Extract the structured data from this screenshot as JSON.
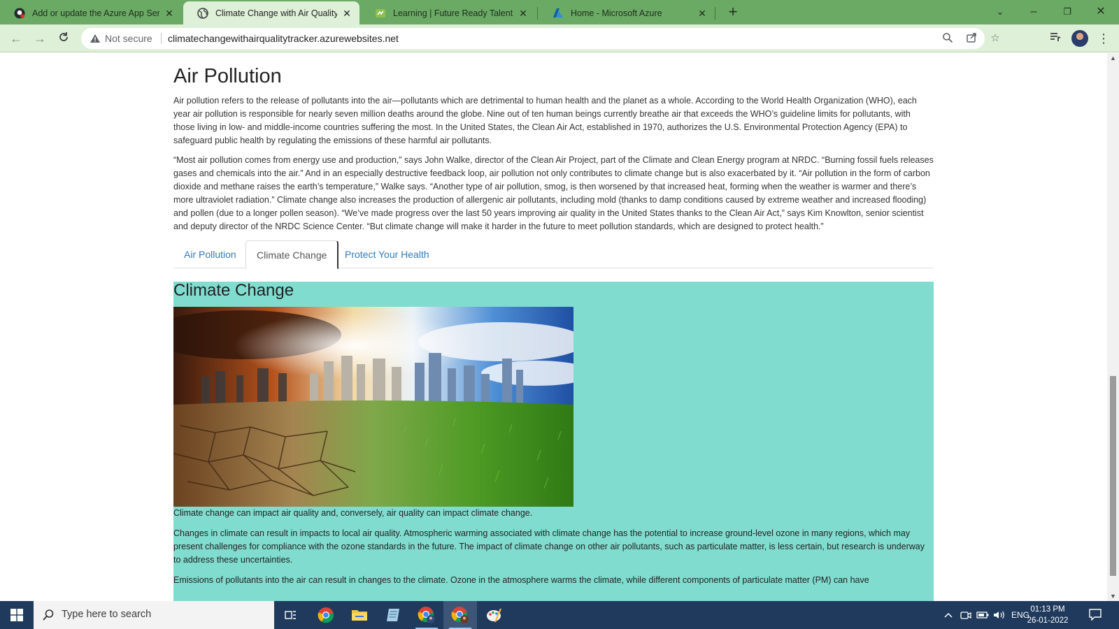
{
  "browser": {
    "tabs": [
      {
        "title": "Add or update the Azure App Servic",
        "icon": "github-icon",
        "active": false
      },
      {
        "title": "Climate Change with Air Quality Tra",
        "icon": "globe-icon",
        "active": true
      },
      {
        "title": "Learning | Future Ready Talent",
        "icon": "future-ready-icon",
        "active": false
      },
      {
        "title": "Home - Microsoft Azure",
        "icon": "azure-icon",
        "active": false
      }
    ],
    "security_label": "Not secure",
    "url": "climatechangewithairqualitytracker.azurewebsites.net"
  },
  "page": {
    "heading": "Air Pollution",
    "paragraphs": [
      "Air pollution refers to the release of pollutants into the air—pollutants which are detrimental to human health and the planet as a whole. According to the World Health Organization (WHO), each year air pollution is responsible for nearly seven million deaths around the globe. Nine out of ten human beings currently breathe air that exceeds the WHO’s guideline limits for pollutants, with those living in low- and middle-income countries suffering the most. In the United States, the Clean Air Act, established in 1970, authorizes the U.S. Environmental Protection Agency (EPA) to safeguard public health by regulating the emissions of these harmful air pollutants.",
      "“Most air pollution comes from energy use and production,” says John Walke, director of the Clean Air Project, part of the Climate and Clean Energy program at NRDC. “Burning fossil fuels releases gases and chemicals into the air.” And in an especially destructive feedback loop, air pollution not only contributes to climate change but is also exacerbated by it. “Air pollution in the form of carbon dioxide and methane raises the earth’s temperature,” Walke says. “Another type of air pollution, smog, is then worsened by that increased heat, forming when the weather is warmer and there’s more ultraviolet radiation.” Climate change also increases the production of allergenic air pollutants, including mold (thanks to damp conditions caused by extreme weather and increased flooding) and pollen (due to a longer pollen season). “We’ve made progress over the last 50 years improving air quality in the United States thanks to the Clean Air Act,” says Kim Knowlton, senior scientist and deputy director of the NRDC Science Center. “But climate change will make it harder in the future to meet pollution standards, which are designed to protect health.”"
    ],
    "tabs": [
      "Air Pollution",
      "Climate Change",
      "Protect Your Health"
    ],
    "active_tab": "Climate Change",
    "panel": {
      "title": "Climate Change",
      "caption": "Climate change can impact air quality and, conversely, air quality can impact climate change.",
      "paragraphs": [
        "Changes in climate can result in impacts to local air quality. Atmospheric warming associated with climate change has the potential to increase ground-level ozone in many regions, which may present challenges for compliance with the ozone standards in the future. The impact of climate change on other air pollutants, such as particulate matter, is less certain, but research is underway to address these uncertainties.",
        "Emissions of pollutants into the air can result in changes to the climate. Ozone in the atmosphere warms the climate, while different components of particulate matter (PM) can have"
      ],
      "background_color": "#80dccf"
    }
  },
  "taskbar": {
    "search_placeholder": "Type here to search",
    "language": "ENG",
    "time": "01:13 PM",
    "date": "26-01-2022"
  },
  "colors": {
    "tabstrip": "#6aaa64",
    "toolbar": "#dff0d8",
    "link": "#337ab7",
    "taskbar": "#1f3a5c"
  }
}
